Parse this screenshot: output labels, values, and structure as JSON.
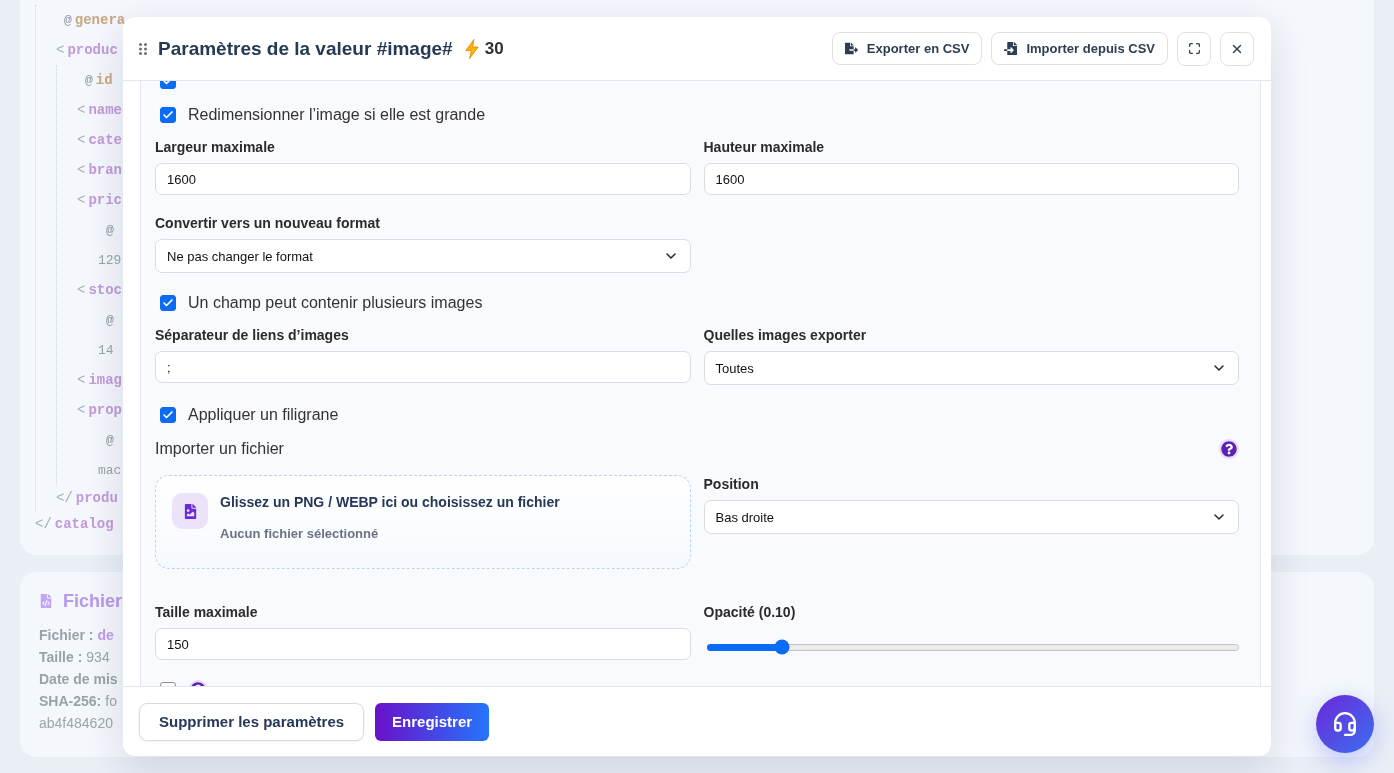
{
  "background": {
    "xml_tree": {
      "children": [
        {
          "kind": "attribute",
          "marker": "@",
          "name": "genera"
        },
        {
          "kind": "element",
          "marker": "<",
          "name": "produc",
          "children": [
            {
              "kind": "attribute",
              "marker": "@",
              "name": "id"
            },
            {
              "kind": "element",
              "marker": "<",
              "name": "name"
            },
            {
              "kind": "element",
              "marker": "<",
              "name": "cate"
            },
            {
              "kind": "element",
              "marker": "<",
              "name": "bran"
            },
            {
              "kind": "element",
              "marker": "<",
              "name": "pric",
              "children": [
                {
                  "kind": "attribute",
                  "marker": "@"
                },
                {
                  "kind": "text",
                  "value": "129"
                }
              ]
            },
            {
              "kind": "element",
              "marker": "<",
              "name": "stoc",
              "children": [
                {
                  "kind": "attribute",
                  "marker": "@"
                },
                {
                  "kind": "text",
                  "value": "14"
                }
              ]
            },
            {
              "kind": "element",
              "marker": "<",
              "name": "imag"
            },
            {
              "kind": "element",
              "marker": "<",
              "name": "prop",
              "children": [
                {
                  "kind": "attribute",
                  "marker": "@"
                },
                {
                  "kind": "text",
                  "value": "mac"
                }
              ]
            }
          ],
          "closing": {
            "marker": "</",
            "name": "produ"
          }
        }
      ],
      "closing": {
        "marker": "</",
        "name": "catalog"
      }
    },
    "file_card": {
      "title": "Fichier",
      "rows": [
        {
          "label": "Fichier :",
          "value": "de",
          "link": true
        },
        {
          "label": "Taille :",
          "value": "934",
          "link": false
        },
        {
          "label": "Date de mis"
        },
        {
          "label": "SHA-256:",
          "value": "fo",
          "link": false
        },
        {
          "value": "ab4f484620",
          "link": false
        }
      ]
    }
  },
  "dialog": {
    "title": "Paramètres de la valeur #image#",
    "credits": "30",
    "header_buttons": [
      {
        "kind": "export",
        "label": "Exporter en CSV"
      },
      {
        "kind": "import",
        "label": "Importer depuis CSV"
      },
      {
        "kind": "fullscreen"
      },
      {
        "kind": "close"
      }
    ],
    "form": [
      {
        "kind": "checkbox",
        "checked": true,
        "help": false
      },
      {
        "kind": "checkbox",
        "label": "Redimensionner l’image si elle est grande",
        "checked": true,
        "help": false
      },
      {
        "kind": "pair",
        "fields": [
          {
            "kind": "input",
            "label": "Largeur maximale",
            "value": "1600"
          },
          {
            "kind": "input",
            "label": "Hauteur maximale",
            "value": "1600"
          }
        ]
      },
      {
        "kind": "pair",
        "fields": [
          {
            "kind": "select",
            "label": "Convertir vers un nouveau format",
            "value": "Ne pas changer le format"
          }
        ]
      },
      {
        "kind": "checkbox",
        "label": "Un champ peut contenir plusieurs images",
        "checked": true,
        "help": false
      },
      {
        "kind": "pair",
        "fields": [
          {
            "kind": "input",
            "label": "Séparateur de liens d’images",
            "value": ";"
          },
          {
            "kind": "select",
            "label": "Quelles images exporter",
            "value": "Toutes"
          }
        ]
      },
      {
        "kind": "checkbox",
        "label": "Appliquer un filigrane",
        "checked": true,
        "help": false
      },
      {
        "kind": "upload",
        "label": "Importer un fichier",
        "help": true,
        "dropzone": {
          "title": "Glissez un PNG / WEBP ici ou choisissez un fichier",
          "status": "Aucun fichier sélectionné"
        },
        "side": {
          "kind": "select",
          "label": "Position",
          "value": "Bas droite"
        }
      },
      {
        "kind": "pair",
        "fields": [
          {
            "kind": "input",
            "label": "Taille maximale",
            "value": "150"
          },
          {
            "kind": "slider",
            "label": "Opacité (0.10)",
            "level": 0.14
          }
        ]
      },
      {
        "kind": "checkbox",
        "checked": false,
        "help": true
      }
    ],
    "footer_buttons": [
      {
        "kind": "secondary",
        "label": "Supprimer les paramètres"
      },
      {
        "kind": "primary",
        "label": "Enregistrer"
      }
    ]
  }
}
